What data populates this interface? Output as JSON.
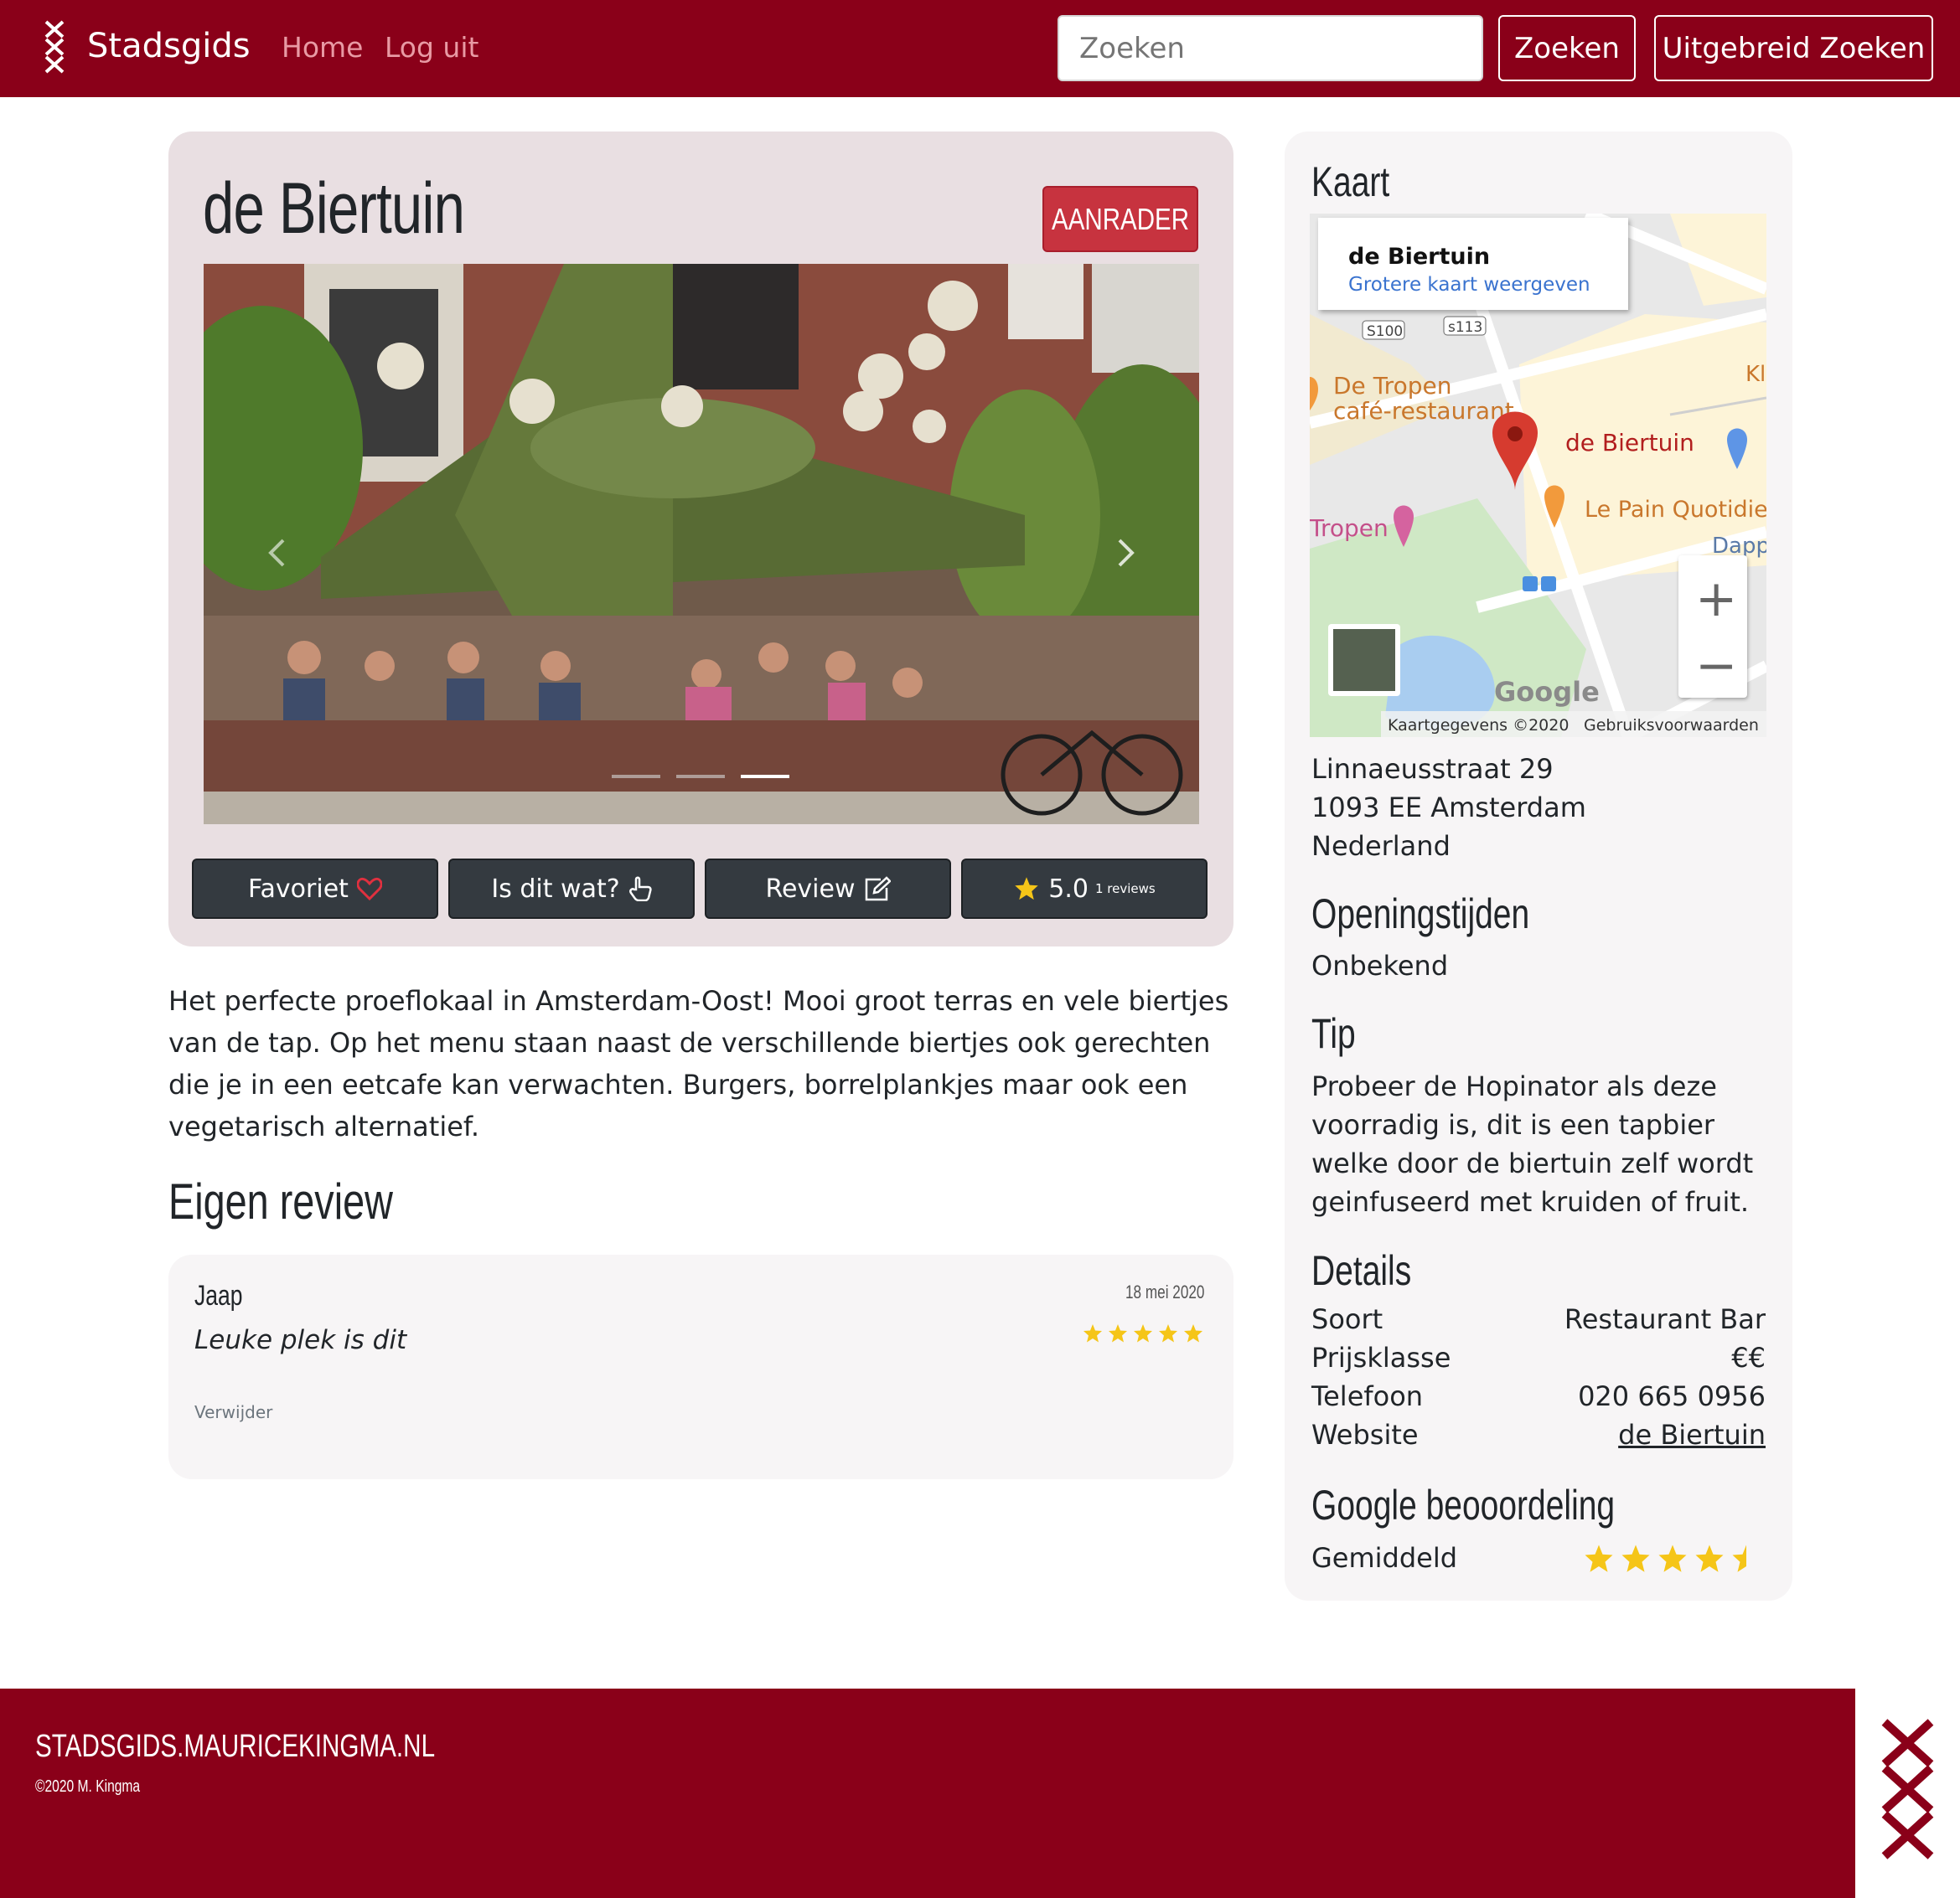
{
  "navbar": {
    "brand": "Stadsgids",
    "links": [
      "Home",
      "Log uit"
    ],
    "search_placeholder": "Zoeken",
    "search_button": "Zoeken",
    "advanced_button": "Uitgebreid Zoeken"
  },
  "place": {
    "title": "de Biertuin",
    "badge": "AANRADER",
    "description": "Het perfecte proeflokaal in Amsterdam-Oost! Mooi groot terras en vele biertjes van de tap. Op het menu staan naast de verschillende biertjes ook gerechten die je in een eetcafe kan verwachten. Burgers, borrelplankjes maar ook een vegetarisch alternatief."
  },
  "actions": {
    "favorite": "Favoriet",
    "is_dit_wat": "Is dit wat?",
    "review": "Review",
    "rating": "5.0",
    "rating_count": "1 reviews"
  },
  "carousel": {
    "slide_count": 3,
    "active_index": 2
  },
  "own_review": {
    "heading": "Eigen review",
    "author": "Jaap",
    "date": "18 mei 2020",
    "text": "Leuke plek is dit",
    "stars": 5,
    "delete": "Verwijder"
  },
  "sidebar": {
    "map_heading": "Kaart",
    "map": {
      "card_title": "de Biertuin",
      "card_link": "Grotere kaart weergeven",
      "pin_label": "de Biertuin",
      "place_1": "De Tropen",
      "place_1_sub": "café-restaurant",
      "place_2": "Le Pain Quotidie",
      "place_3": "Tropen",
      "road_1": "S100",
      "road_2": "s113",
      "edge_1": "Kl",
      "edge_2": "Dapp",
      "zoom_in": "+",
      "zoom_out": "−",
      "logo": "Google",
      "attribution": "Kaartgegevens ©2020",
      "terms": "Gebruiksvoorwaarden"
    },
    "address": [
      "Linnaeusstraat 29",
      "1093 EE Amsterdam",
      "Nederland"
    ],
    "hours_heading": "Openingstijden",
    "hours": "Onbekend",
    "tip_heading": "Tip",
    "tip": "Probeer de Hopinator als deze voorradig is, dit is een tapbier welke door de biertuin zelf wordt geinfuseerd met kruiden of fruit.",
    "details_heading": "Details",
    "details": [
      {
        "label": "Soort",
        "value": "Restaurant Bar"
      },
      {
        "label": "Prijsklasse",
        "value": "€€"
      },
      {
        "label": "Telefoon",
        "value": "020 665 0956"
      },
      {
        "label": "Website",
        "value": "de Biertuin"
      }
    ],
    "google_heading": "Google beooordeling",
    "google_label": "Gemiddeld",
    "google_rating": 4.5
  },
  "footer": {
    "site": "STADSGIDS.MAURICEKINGMA.NL",
    "copyright": "©2020 M. Kingma"
  },
  "colors": {
    "brand": "#8a0019",
    "badge": "#c7333f",
    "button_dark": "#343a40",
    "card_bg": "#e9dfe2",
    "star": "#f5c518"
  }
}
